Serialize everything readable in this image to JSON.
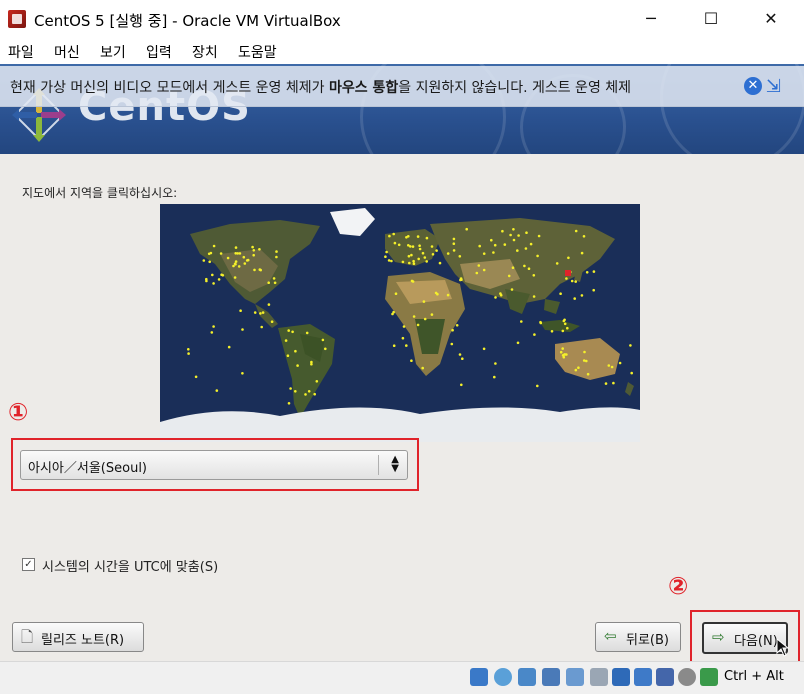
{
  "window": {
    "title": "CentOS 5 [실행 중] - Oracle VM VirtualBox",
    "minimize": "─",
    "maximize": "☐",
    "close": "✕"
  },
  "menu": [
    "파일",
    "머신",
    "보기",
    "입력",
    "장치",
    "도움말"
  ],
  "notice": {
    "text_before": "현재 가상 머신의 비디오 모드에서 게스트 운영 체제가 ",
    "bold": "마우스 통합",
    "text_after": "을 지원하지 않습니다. 게스트 운영 체제",
    "close_glyph": "✕",
    "mouse_glyph": "⇲"
  },
  "installer": {
    "logo_text": "CentOS",
    "prompt": "지도에서 지역을 클릭하십시오:",
    "timezone_value": "아시아／서울(Seoul)",
    "utc_checked": true,
    "utc_check_glyph": "✓",
    "utc_label": "시스템의 시간을 UTC에 맞춤(S)",
    "release_notes": "릴리즈 노트(R)",
    "back": "뒤로(B)",
    "next": "다음(N)"
  },
  "annotations": {
    "one": "①",
    "two": "②"
  },
  "statusbar": {
    "hostkey": "Ctrl + Alt"
  },
  "colors": {
    "callout": "#e0232a",
    "banner": "#2a5190",
    "selected_city": "#e0232a"
  }
}
